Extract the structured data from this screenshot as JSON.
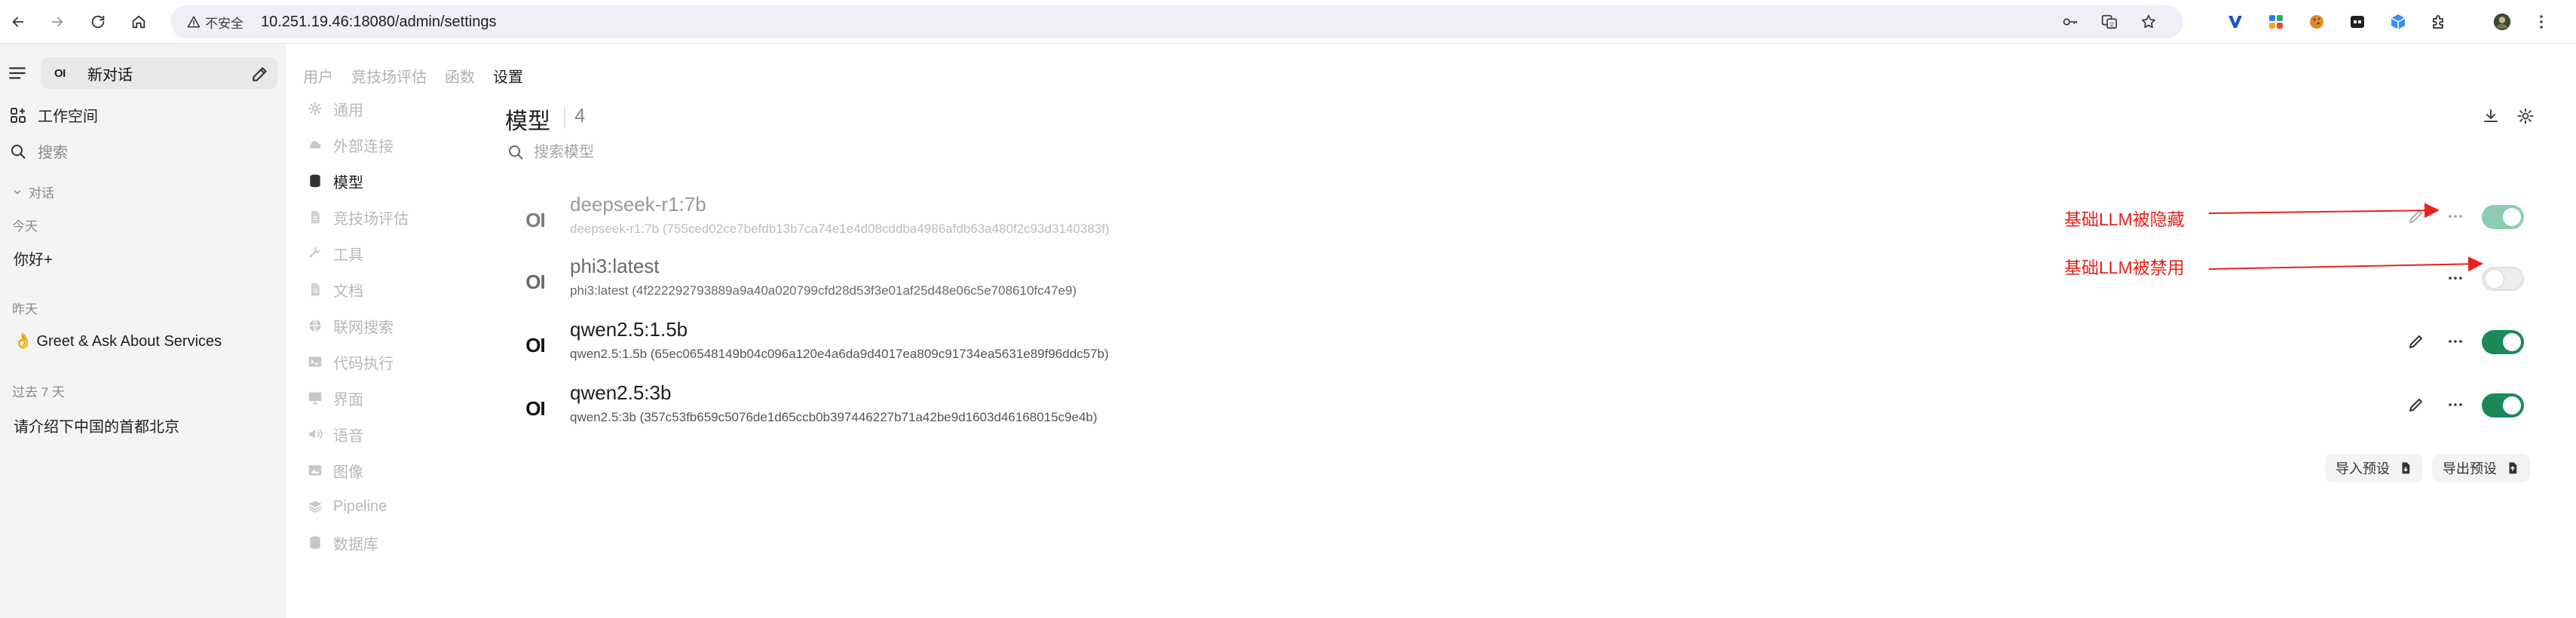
{
  "browser": {
    "insecure_label": "不安全",
    "url": "10.251.19.46:18080/admin/settings"
  },
  "sidebar": {
    "new_chat_logo": "OI",
    "new_chat_label": "新对话",
    "workspace_label": "工作空间",
    "search_label": "搜索",
    "conversations_label": "对话",
    "groups": [
      {
        "label": "今天",
        "chats": [
          "你好+"
        ]
      },
      {
        "label": "昨天",
        "chats": [
          "👌 Greet & Ask About Services"
        ]
      },
      {
        "label": "过去 7 天",
        "chats": [
          "请介绍下中国的首都北京"
        ]
      }
    ]
  },
  "tabs": [
    {
      "label": "用户",
      "active": false
    },
    {
      "label": "竞技场评估",
      "active": false
    },
    {
      "label": "函数",
      "active": false
    },
    {
      "label": "设置",
      "active": true
    }
  ],
  "settings_nav": [
    {
      "label": "通用",
      "icon": "gear-icon",
      "active": false
    },
    {
      "label": "外部连接",
      "icon": "cloud-icon",
      "active": false
    },
    {
      "label": "模型",
      "icon": "database-icon",
      "active": true
    },
    {
      "label": "竞技场评估",
      "icon": "document-icon",
      "active": false
    },
    {
      "label": "工具",
      "icon": "wrench-icon",
      "active": false
    },
    {
      "label": "文档",
      "icon": "document-icon",
      "active": false
    },
    {
      "label": "联网搜索",
      "icon": "globe-icon",
      "active": false
    },
    {
      "label": "代码执行",
      "icon": "terminal-icon",
      "active": false
    },
    {
      "label": "界面",
      "icon": "monitor-icon",
      "active": false
    },
    {
      "label": "语音",
      "icon": "speaker-icon",
      "active": false
    },
    {
      "label": "图像",
      "icon": "image-icon",
      "active": false
    },
    {
      "label": "Pipeline",
      "icon": "stack-icon",
      "active": false
    },
    {
      "label": "数据库",
      "icon": "database-icon",
      "active": false
    }
  ],
  "main": {
    "title": "模型",
    "count": "4",
    "search_placeholder": "搜索模型",
    "models": [
      {
        "logo": "OI",
        "name": "deepseek-r1:7b",
        "hash": "deepseek-r1:7b (755ced02ce7befdb13b7ca74e1e4d08cddba4986afdb63a480f2c93d3140383f)",
        "enabled": true,
        "hidden": true
      },
      {
        "logo": "OI",
        "name": "phi3:latest",
        "hash": "phi3:latest (4f222292793889a9a40a020799cfd28d53f3e01af25d48e06c5e708610fc47e9)",
        "enabled": false,
        "hidden": false
      },
      {
        "logo": "OI",
        "name": "qwen2.5:1.5b",
        "hash": "qwen2.5:1.5b (65ec06548149b04c096a120e4a6da9d4017ea809c91734ea5631e89f96ddc57b)",
        "enabled": true,
        "hidden": false
      },
      {
        "logo": "OI",
        "name": "qwen2.5:3b",
        "hash": "qwen2.5:3b (357c53fb659c5076de1d65ccb0b397446227b71a42be9d1603d46168015c9e4b)",
        "enabled": true,
        "hidden": false
      }
    ],
    "import_presets": "导入预设",
    "export_presets": "导出预设"
  },
  "annotations": {
    "hidden_note": "基础LLM被隐藏",
    "disabled_note": "基础LLM被禁用",
    "color": "#e8211c"
  },
  "colors": {
    "toggle_on": "#1b8a5a",
    "sidebar_bg": "#f4f4f4"
  }
}
